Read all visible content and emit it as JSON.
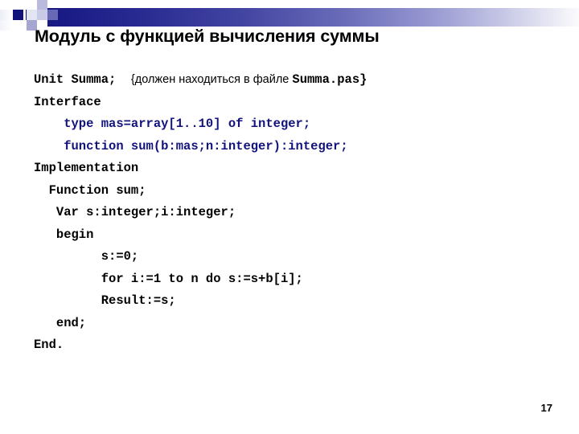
{
  "slide": {
    "title": "Модуль с функцией вычисления суммы",
    "page_number": "17",
    "accent_color": "#12137c",
    "band_start_color": "#14157f",
    "band_end_color": "#fbfbfd"
  },
  "code": {
    "lines": [
      {
        "id": "line-unit",
        "indent": 0,
        "color": "black",
        "segments": [
          {
            "kind": "code",
            "text": "Unit Summa;  "
          },
          {
            "kind": "comment",
            "text": "{должен находиться в файле "
          },
          {
            "kind": "code",
            "text": "Summa.pas}"
          }
        ],
        "plain": "Unit Summa;  {должен находиться в файле Summa.pas}"
      },
      {
        "id": "line-interface",
        "indent": 0,
        "color": "black",
        "segments": [
          {
            "kind": "code",
            "text": "Interface"
          }
        ],
        "plain": "Interface"
      },
      {
        "id": "line-type-mas",
        "indent": 4,
        "color": "blue",
        "segments": [
          {
            "kind": "code",
            "text": "    type mas=array[1..10] of integer;"
          }
        ],
        "plain": "    type mas=array[1..10] of integer;"
      },
      {
        "id": "line-function-sum-decl",
        "indent": 4,
        "color": "blue",
        "segments": [
          {
            "kind": "code",
            "text": "    function sum(b:mas;n:integer):integer;"
          }
        ],
        "plain": "    function sum(b:mas;n:integer):integer;"
      },
      {
        "id": "line-implementation",
        "indent": 0,
        "color": "black",
        "segments": [
          {
            "kind": "code",
            "text": "Implementation"
          }
        ],
        "plain": "Implementation"
      },
      {
        "id": "line-function-sum-def",
        "indent": 2,
        "color": "black",
        "segments": [
          {
            "kind": "code",
            "text": "  Function sum;"
          }
        ],
        "plain": "  Function sum;"
      },
      {
        "id": "line-var",
        "indent": 3,
        "color": "black",
        "segments": [
          {
            "kind": "code",
            "text": "   Var s:integer;i:integer;"
          }
        ],
        "plain": "   Var s:integer;i:integer;"
      },
      {
        "id": "line-begin",
        "indent": 3,
        "color": "black",
        "segments": [
          {
            "kind": "code",
            "text": "   begin"
          }
        ],
        "plain": "   begin"
      },
      {
        "id": "line-s-init",
        "indent": 9,
        "color": "black",
        "segments": [
          {
            "kind": "code",
            "text": "         s:=0;"
          }
        ],
        "plain": "         s:=0;"
      },
      {
        "id": "line-for-loop",
        "indent": 9,
        "color": "black",
        "segments": [
          {
            "kind": "code",
            "text": "         for i:=1 to n do s:=s+b[i];"
          }
        ],
        "plain": "         for i:=1 to n do s:=s+b[i];"
      },
      {
        "id": "line-result",
        "indent": 9,
        "color": "black",
        "segments": [
          {
            "kind": "code",
            "text": "         Result:=s;"
          }
        ],
        "plain": "         Result:=s;"
      },
      {
        "id": "line-end-semicolon",
        "indent": 3,
        "color": "black",
        "segments": [
          {
            "kind": "code",
            "text": "   end;"
          }
        ],
        "plain": "   end;"
      },
      {
        "id": "line-end-dot",
        "indent": 0,
        "color": "black",
        "segments": [
          {
            "kind": "code",
            "text": "End."
          }
        ],
        "plain": "End."
      }
    ]
  }
}
